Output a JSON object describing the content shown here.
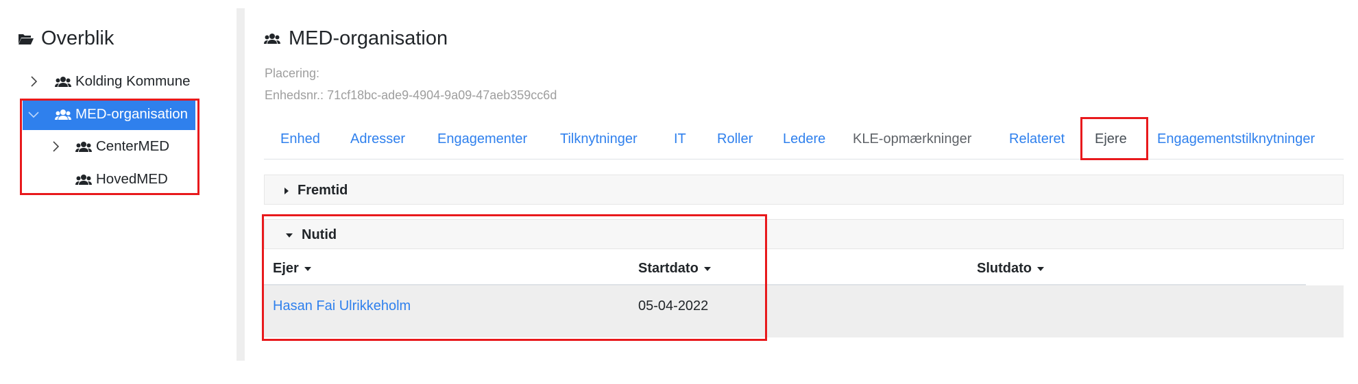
{
  "sidebar": {
    "title": "Overblik",
    "items": [
      {
        "label": "Kolding Kommune"
      },
      {
        "label": "MED-organisation"
      },
      {
        "label": "CenterMED"
      },
      {
        "label": "HovedMED"
      }
    ]
  },
  "main": {
    "title": "MED-organisation",
    "placering_label": "Placering:",
    "enhedsnr": "Enhedsnr.: 71cf18bc-ade9-4904-9a09-47aeb359cc6d"
  },
  "tabs": [
    {
      "label": "Enhed"
    },
    {
      "label": "Adresser"
    },
    {
      "label": "Engagementer"
    },
    {
      "label": "Tilknytninger"
    },
    {
      "label": "IT"
    },
    {
      "label": "Roller"
    },
    {
      "label": "Ledere"
    },
    {
      "label": "KLE-opmærkninger"
    },
    {
      "label": "Relateret"
    },
    {
      "label": "Ejere"
    },
    {
      "label": "Engagementstilknytninger"
    }
  ],
  "sections": {
    "future_label": "Fremtid",
    "present_label": "Nutid"
  },
  "table": {
    "columns": [
      "Ejer",
      "Startdato",
      "Slutdato"
    ],
    "rows": [
      {
        "ejer": "Hasan Fai Ulrikkeholm",
        "startdato": "05-04-2022",
        "slutdato": ""
      }
    ]
  },
  "colors": {
    "accent": "#2f80ed",
    "highlight": "#e8191c"
  }
}
